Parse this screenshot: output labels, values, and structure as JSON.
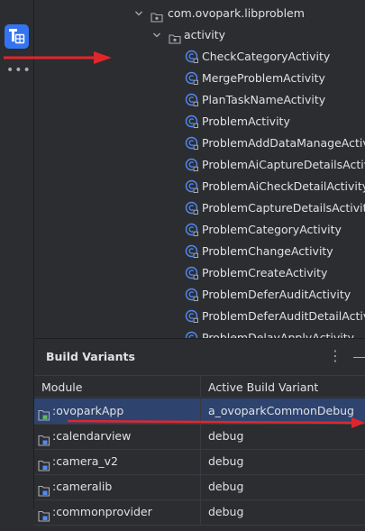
{
  "sidebar": {
    "build_variants_icon": "build-variants-icon",
    "more_label": "•••"
  },
  "tree": {
    "package": "com.ovopark.libproblem",
    "folder": "activity",
    "items": [
      "CheckCategoryActivity",
      "MergeProblemActivity",
      "PlanTaskNameActivity",
      "ProblemActivity",
      "ProblemAddDataManageActivity",
      "ProblemAiCaptureDetailsActivity",
      "ProblemAiCheckDetailActivity",
      "ProblemCaptureDetailsActivity",
      "ProblemCategoryActivity",
      "ProblemChangeActivity",
      "ProblemCreateActivity",
      "ProblemDeferAuditActivity",
      "ProblemDeferAuditDetailActivity",
      "ProblemDelayApplyActivity"
    ]
  },
  "build_variants": {
    "title": "Build Variants",
    "menu_label": "⋮",
    "columns": [
      "Module",
      "Active Build Variant"
    ],
    "rows": [
      {
        "module": ":ovoparkApp",
        "variant": "a_ovoparkCommonDebug",
        "selected": true
      },
      {
        "module": ":calendarview",
        "variant": "debug",
        "selected": false
      },
      {
        "module": ":camera_v2",
        "variant": "debug",
        "selected": false
      },
      {
        "module": ":cameralib",
        "variant": "debug",
        "selected": false
      },
      {
        "module": ":commonprovider",
        "variant": "debug",
        "selected": false
      }
    ]
  },
  "colors": {
    "accent": "#3574f0",
    "annotation_arrow": "#e0262b",
    "app_module_icon": "#5fb865",
    "lib_module_icon": "#548af7"
  }
}
